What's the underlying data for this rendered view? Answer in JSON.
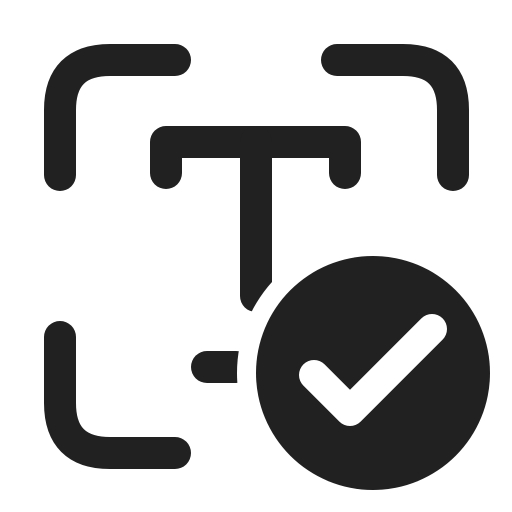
{
  "icon": {
    "name": "text-recognition-check-icon",
    "ink_color": "#212121",
    "check_color": "#ffffff",
    "background_color": "#ffffff"
  }
}
